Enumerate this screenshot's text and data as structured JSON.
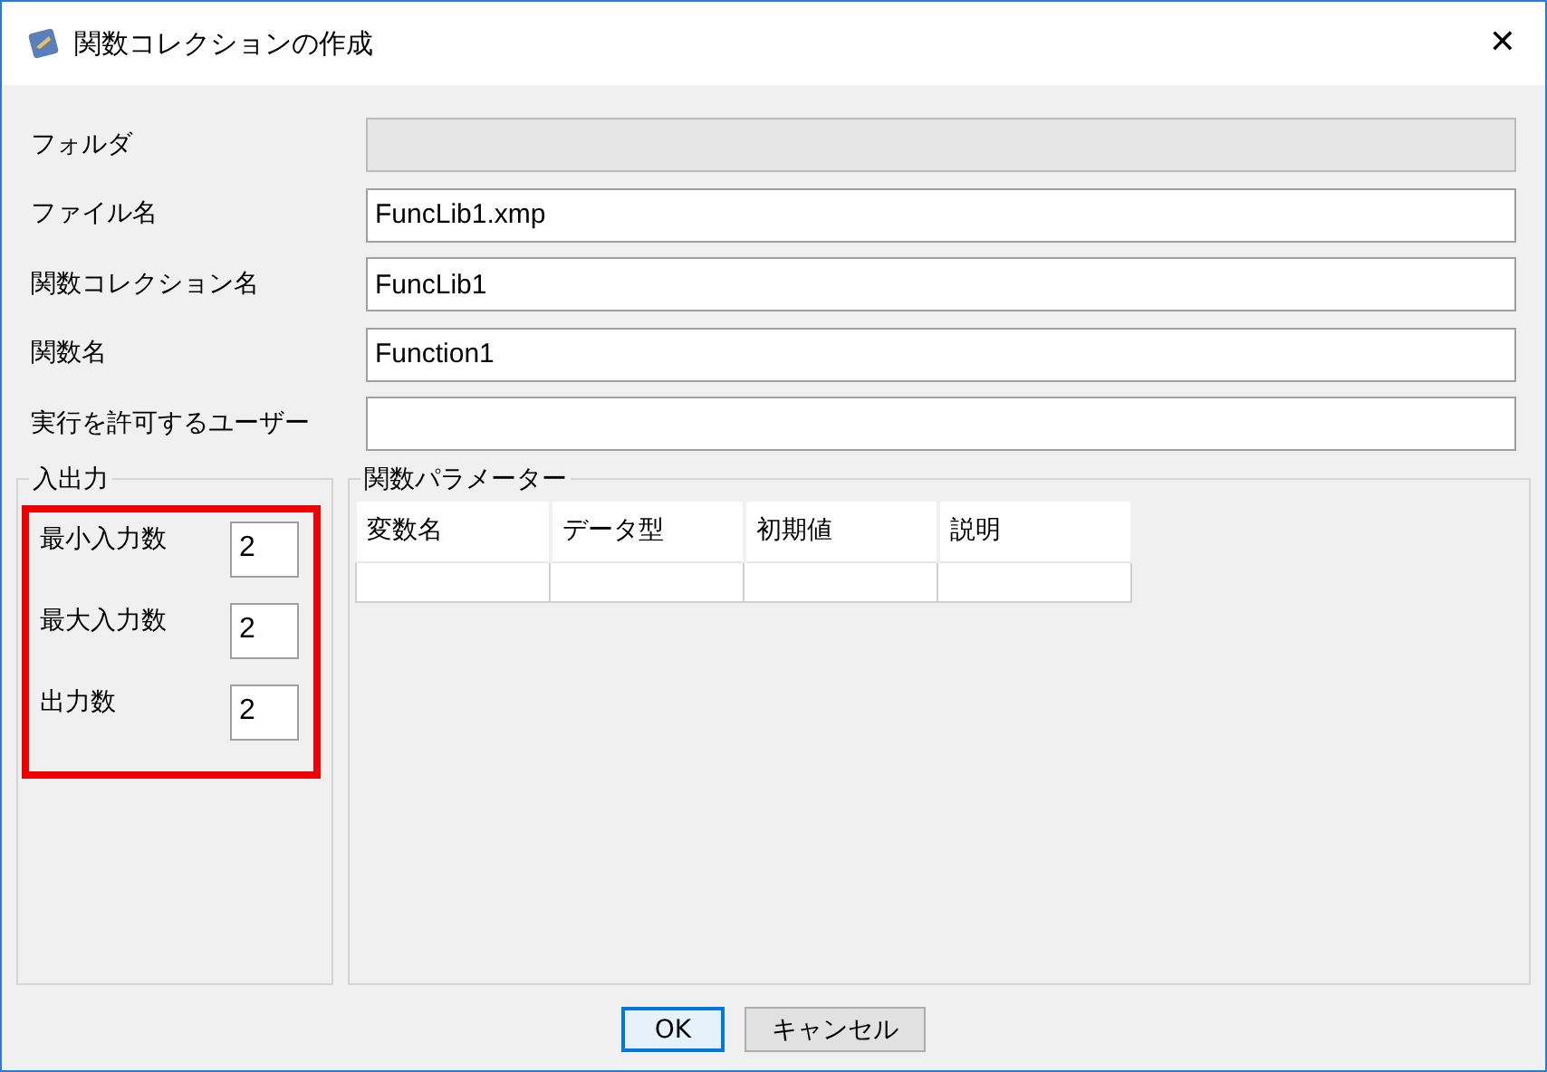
{
  "window": {
    "title": "関数コレクションの作成",
    "close": "✕"
  },
  "fields": [
    {
      "label": "フォルダ",
      "disabled": true
    },
    {
      "label": "ファイル名",
      "value": "FuncLib1.xmp",
      "disabled": false
    },
    {
      "label": "関数コレクション名",
      "value": "FuncLib1",
      "disabled": false
    },
    {
      "label": "関数名",
      "value": "Function1",
      "disabled": false
    },
    {
      "label": "実行を許可するユーザー",
      "disabled": false
    }
  ],
  "io": {
    "title": "入出力",
    "highlighted": true,
    "items": [
      {
        "label": "最小入力数",
        "value": "2"
      },
      {
        "label": "最大入力数",
        "value": "2"
      },
      {
        "label": "出力数",
        "value": "2"
      }
    ]
  },
  "params": {
    "title": "関数パラメーター",
    "columns": [
      "変数名",
      "データ型",
      "初期値",
      "説明"
    ]
  },
  "buttons": [
    {
      "label": "OK",
      "default": true
    },
    {
      "label": "キャンセル",
      "default": false
    }
  ]
}
